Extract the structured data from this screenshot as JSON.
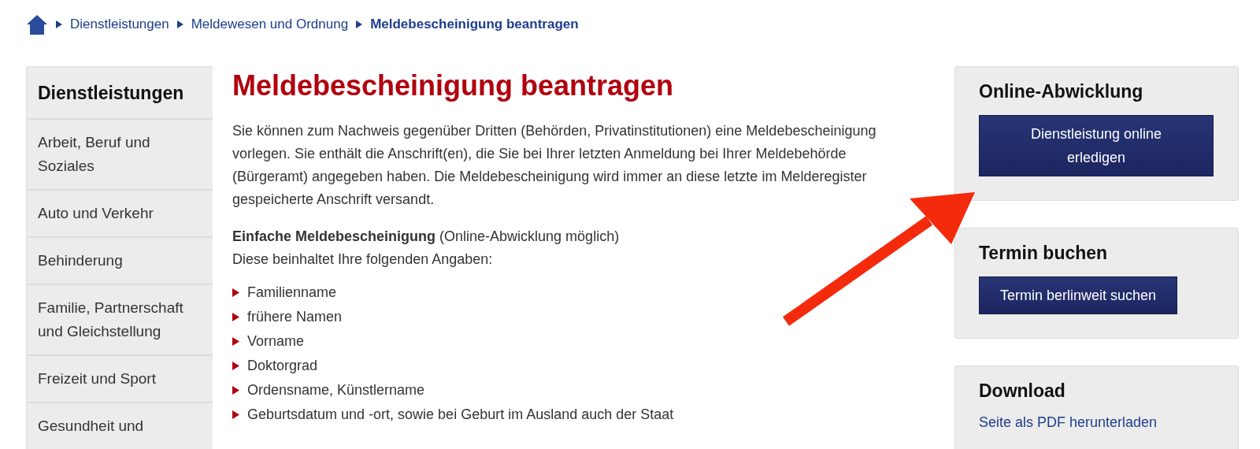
{
  "breadcrumb": [
    {
      "label": "Dienstleistungen",
      "current": false
    },
    {
      "label": "Meldewesen und Ordnung",
      "current": false
    },
    {
      "label": "Meldebescheinigung beantragen",
      "current": true
    }
  ],
  "sidebar": {
    "title": "Dienstleistungen",
    "items": [
      "Arbeit, Beruf und Soziales",
      "Auto und Verkehr",
      "Behinderung",
      "Familie, Partnerschaft und Gleichstellung",
      "Freizeit und Sport",
      "Gesundheit und"
    ]
  },
  "main": {
    "title": "Meldebescheinigung beantragen",
    "intro": "Sie können zum Nachweis gegenüber Dritten (Behörden, Privatinstitutionen) eine Meldebescheinigung vorlegen. Sie enthält die Anschrift(en), die Sie bei Ihrer letzten Anmeldung bei Ihrer Meldebehörde (Bürgeramt) angegeben haben. Die Meldebescheinigung wird immer an diese letzte im Melderegister gespeicherte Anschrift versandt.",
    "subheading": "**Einfache Meldebescheinigung** (Online-Abwicklung möglich)",
    "lead": "Diese beinhaltet Ihre folgenden Angaben:",
    "list": [
      "Familienname",
      "frühere Namen",
      "Vorname",
      "Doktorgrad",
      "Ordensname, Künstlername",
      "Geburtsdatum und -ort, sowie bei Geburt im Ausland auch der Staat"
    ]
  },
  "aside": [
    {
      "kind": "button",
      "title": "Online-Abwicklung",
      "action": "Dienstleistung online erledigen"
    },
    {
      "kind": "button",
      "title": "Termin buchen",
      "action": "Termin berlinweit suchen"
    },
    {
      "kind": "link",
      "title": "Download",
      "action": "Seite als PDF herunterladen"
    }
  ]
}
